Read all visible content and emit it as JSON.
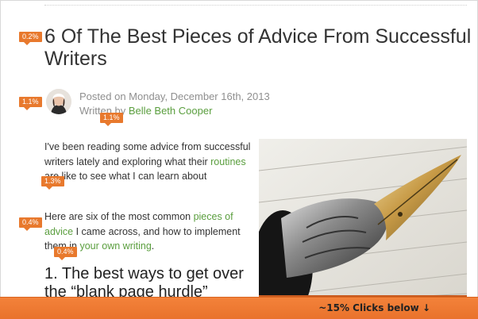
{
  "article": {
    "title": "6 Of The Best Pieces of Advice From Successful Writers",
    "posted_prefix": "Posted on ",
    "posted_date": "Monday, December 16th, 2013",
    "written_prefix": "Written by ",
    "author": "Belle Beth Cooper",
    "para1_a": "I've been reading some advice from successful writers lately and exploring what their ",
    "para1_link": "routines",
    "para1_b": " are like to see what I can learn about",
    "para2_a": "Here are six of the most common ",
    "para2_link1": "pieces of advice",
    "para2_b": " I came across, and how to implement them in ",
    "para2_link2": "your own writing",
    "para2_c": ".",
    "heading1": "1. The best ways to get over the “blank page hurdle”"
  },
  "tags": {
    "title": "0.2%",
    "avatar": "1.1%",
    "author": "1.1%",
    "routines": "1.3%",
    "advice": "0.4%",
    "writing": "0.4%"
  },
  "scroll_bar": {
    "label": "~15% Clicks below ↓"
  },
  "colors": {
    "link": "#5a9e3e",
    "tag": "#e8792d",
    "bar": "#f3823a"
  }
}
